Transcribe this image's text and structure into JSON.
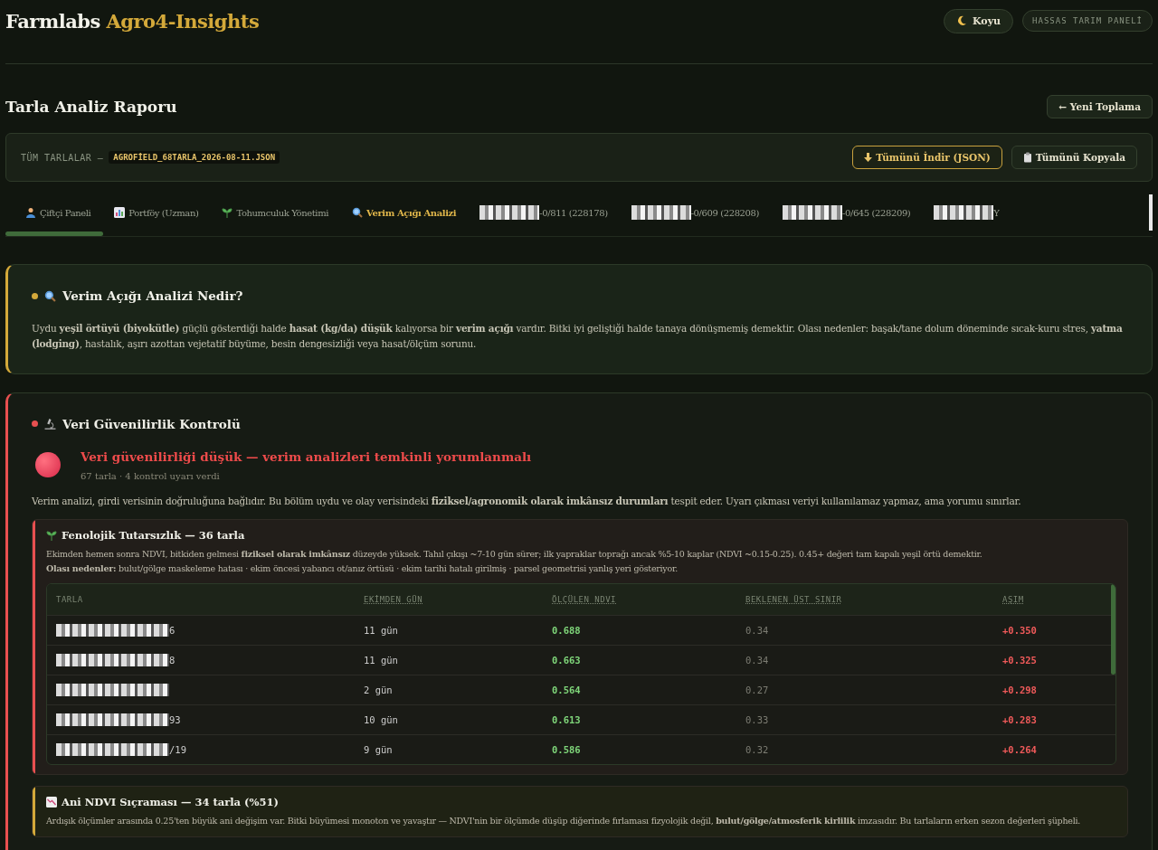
{
  "header": {
    "brand": "Farmlabs",
    "brand_accent": "Agro4-Insights",
    "theme_button": "Koyu",
    "badge": "HASSAS TARIM PANELİ"
  },
  "report": {
    "title": "Tarla Analiz Raporu",
    "new_button": "← Yeni Toplama"
  },
  "source_bar": {
    "label": "TÜM TARLALAR —",
    "file": "AGROFİELD_68TARLA_2026-08-11.JSON",
    "download_button": "Tümünü İndir (JSON)",
    "copy_button": "Tümünü Kopyala"
  },
  "tabs": [
    {
      "kind": "farmer",
      "label": "Çiftçi Paneli",
      "selected": false
    },
    {
      "kind": "chart",
      "label": "Portföy (Uzman)",
      "selected": false
    },
    {
      "kind": "seedling",
      "label": "Tohumculuk Yönetimi",
      "selected": false
    },
    {
      "kind": "search",
      "label": "Verim Açığı Analizi",
      "selected": true
    },
    {
      "kind": "redacted",
      "label": "-0/811 (228178)",
      "selected": false
    },
    {
      "kind": "redacted",
      "label": "-0/609 (228208)",
      "selected": false
    },
    {
      "kind": "redacted",
      "label": "-0/645 (228209)",
      "selected": false
    },
    {
      "kind": "redacted",
      "label": "Y",
      "selected": false
    }
  ],
  "info_card": {
    "color": "#d4a93a",
    "title": "Verim Açığı Analizi Nedir?",
    "text": "Uydu **yeşil örtüyü (biyokütle)** güçlü gösterdiği halde **hasat (kg/da) düşük** kalıyorsa bir **verim açığı** vardır. Bitki iyi geliştiği halde tanaya dönüşmemiş demektir. Olası nedenler: başak/tane dolum döneminde sıcak-kuru stres, **yatma (lodging)**, hastalık, aşırı azottan vejetatif büyüme, besin dengesizliği veya hasat/ölçüm sorunu."
  },
  "reliability_card": {
    "color": "#e85050",
    "title": "Veri Güvenilirlik Kontrolü",
    "status": {
      "headline": "Veri güvenilirliği düşük — verim analizleri temkinli yorumlanmalı",
      "subline": "67 tarla · 4 kontrol uyarı verdi"
    },
    "intro": "Verim analizi, girdi verisinin doğruluğuna bağlıdır. Bu bölüm uydu ve olay verisindeki **fiziksel/agronomik olarak imkânsız durumları** tespit eder. Uyarı çıkması veriyi kullanılamaz yapmaz, ama yorumu sınırlar.",
    "checks": [
      {
        "kind": "seedling",
        "color": "#e85050",
        "title": "Fenolojik Tutarsızlık — 36 tarla",
        "description": [
          "Ekimden hemen sonra NDVI, bitkiden gelmesi **fiziksel olarak imkânsız** düzeyde yüksek. Tahıl çıkışı ~7-10 gün sürer; ilk yapraklar toprağı ancak %5-10 kaplar (NDVI ~0.15-0.25). 0.45+ değeri tam kapalı yeşil örtü demektir.",
          "**Olası nedenler:** bulut/gölge maskeleme hatası · ekim öncesi yabancı ot/anız örtüsü · ekim tarihi hatalı girilmiş · parsel geometrisi yanlış yeri gösteriyor."
        ],
        "table": {
          "columns": [
            {
              "label": "TARLA",
              "sortable": false
            },
            {
              "label": "EKİMDEN GÜN",
              "sortable": true
            },
            {
              "label": "ÖLÇÜLEN NDVI",
              "sortable": true
            },
            {
              "label": "BEKLENEN ÜST SINIR",
              "sortable": true
            },
            {
              "label": "AŞIM",
              "sortable": true
            }
          ],
          "rows": [
            {
              "field": "6",
              "days": "11 gün",
              "ndvi": "0.688",
              "limit": "0.34",
              "excess": "+0.350"
            },
            {
              "field": "8",
              "days": "11 gün",
              "ndvi": "0.663",
              "limit": "0.34",
              "excess": "+0.325"
            },
            {
              "days": "2 gün",
              "ndvi": "0.564",
              "limit": "0.27",
              "excess": "+0.298"
            },
            {
              "field": "93",
              "days": "10 gün",
              "ndvi": "0.613",
              "limit": "0.33",
              "excess": "+0.283"
            },
            {
              "field": "/19",
              "days": "9 gün",
              "ndvi": "0.586",
              "limit": "0.32",
              "excess": "+0.264"
            }
          ]
        }
      },
      {
        "kind": "chart-down",
        "color": "#d4a93a",
        "title": "Ani NDVI Sıçraması — 34 tarla (%51)",
        "description": [
          "Ardışık ölçümler arasında 0.25'ten büyük ani değişim var. Bitki büyümesi monoton ve yavaştır — NDVI'nin bir ölçümde düşüp diğerinde fırlaması fizyolojik değil, **bulut/gölge/atmosferik kirlilik** imzasıdır. Bu tarlaların erken sezon değerleri şüpheli."
        ]
      }
    ]
  }
}
